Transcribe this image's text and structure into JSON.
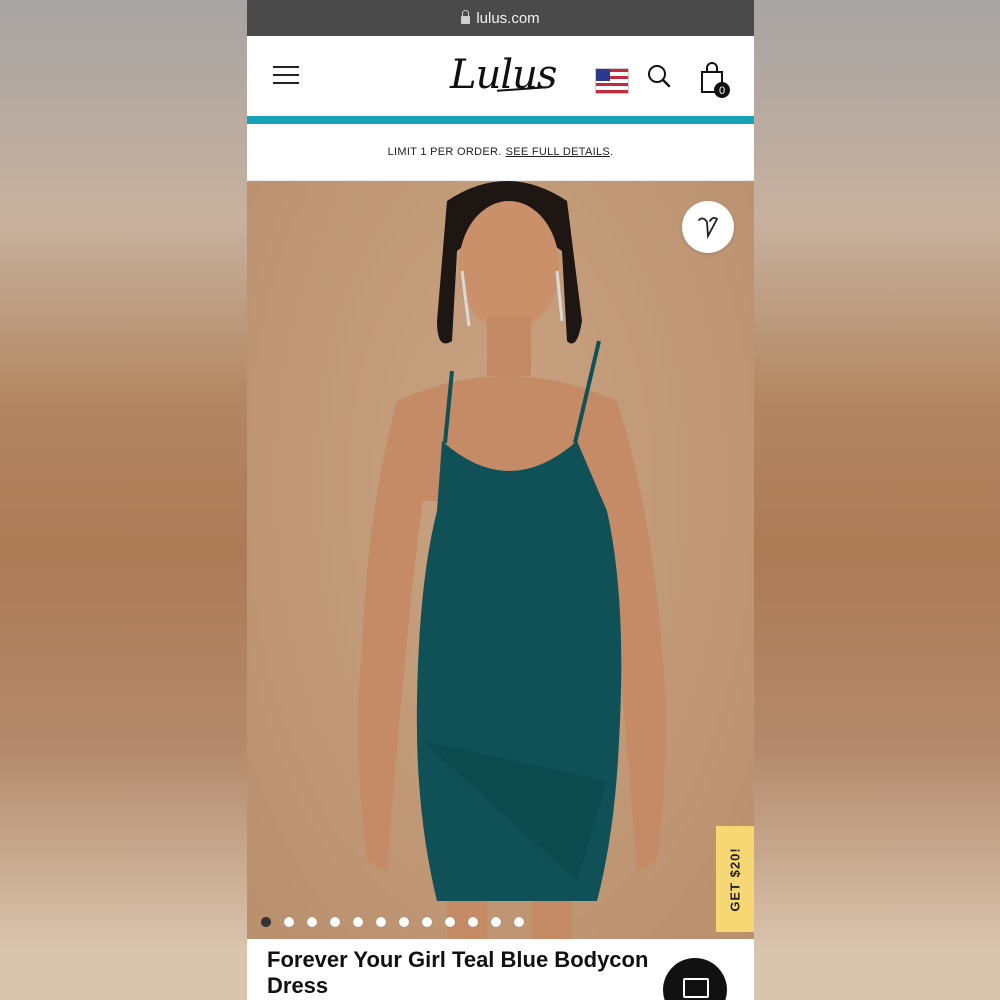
{
  "browser": {
    "url": "lulus.com"
  },
  "header": {
    "logo_text": "Lulus",
    "cart_count": "0"
  },
  "promo": {
    "text": "LIMIT 1 PER ORDER.",
    "link": "SEE FULL DETAILS",
    "suffix": "."
  },
  "product": {
    "title": "Forever Your Girl Teal Blue Bodycon Dress",
    "image_count": 12,
    "active_image_index": 0,
    "image_description_colors": {
      "background": "#c29b79",
      "dress": "#0f5156"
    }
  },
  "side_tab": {
    "label": "GET $20!"
  },
  "colors": {
    "accent_teal": "#17a2b8",
    "promo_tab_yellow": "#f7d774",
    "chat_button": "#111111"
  }
}
